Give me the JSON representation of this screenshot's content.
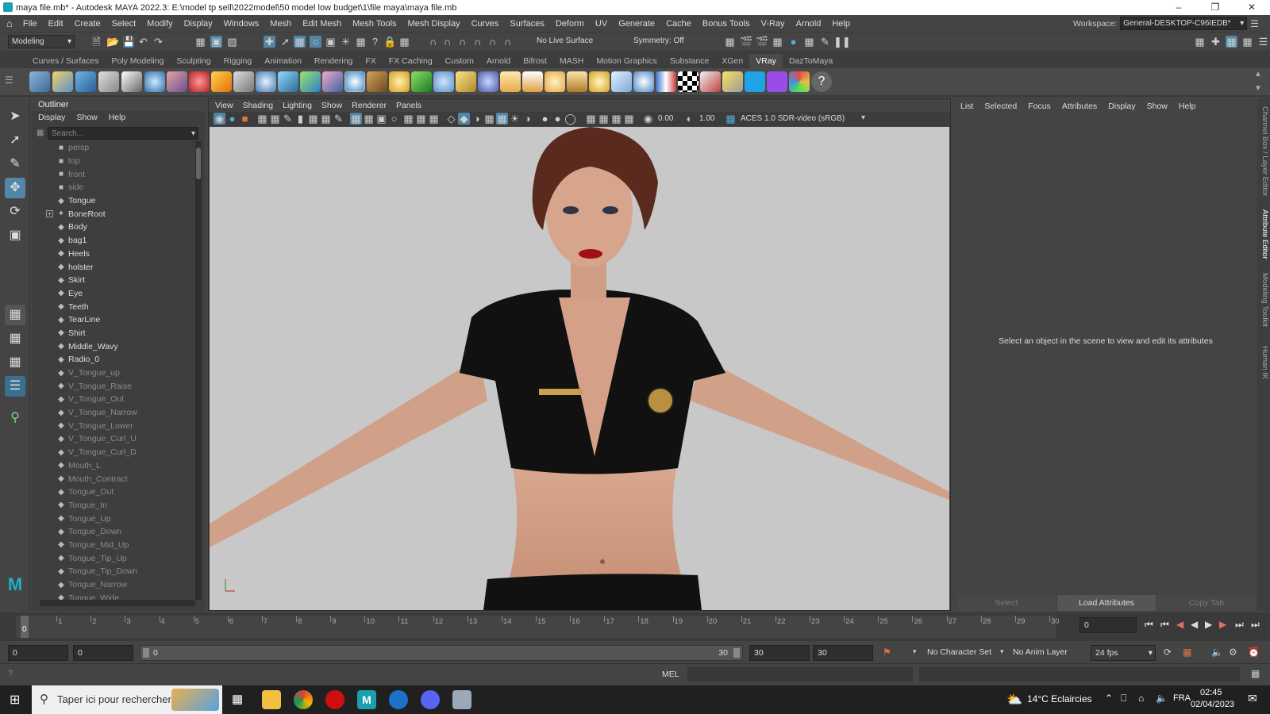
{
  "window": {
    "title": "maya file.mb* - Autodesk MAYA 2022.3: E:\\model tp sell\\2022model\\50 model low budget\\1\\file maya\\maya file.mb"
  },
  "menubar": {
    "items": [
      "File",
      "Edit",
      "Create",
      "Select",
      "Modify",
      "Display",
      "Windows",
      "Mesh",
      "Edit Mesh",
      "Mesh Tools",
      "Mesh Display",
      "Curves",
      "Surfaces",
      "Deform",
      "UV",
      "Generate",
      "Cache",
      "Bonus Tools",
      "V-Ray",
      "Arnold",
      "Help"
    ],
    "workspace_label": "Workspace:",
    "workspace_value": "General-DESKTOP-C96IEDB*"
  },
  "statusline": {
    "mode": "Modeling",
    "live_surface": "No Live Surface",
    "symmetry": "Symmetry: Off"
  },
  "shelf": {
    "tabs": [
      "Curves / Surfaces",
      "Poly Modeling",
      "Sculpting",
      "Rigging",
      "Animation",
      "Rendering",
      "FX",
      "FX Caching",
      "Custom",
      "Arnold",
      "Bifrost",
      "MASH",
      "Motion Graphics",
      "Substance",
      "XGen",
      "VRay",
      "DazToMaya"
    ],
    "active_tab": "VRay"
  },
  "outliner": {
    "title": "Outliner",
    "menu": [
      "Display",
      "Show",
      "Help"
    ],
    "search_placeholder": "Search...",
    "items": [
      {
        "label": "persp",
        "icon": "camera-icon",
        "dim": true
      },
      {
        "label": "top",
        "icon": "camera-icon",
        "dim": true
      },
      {
        "label": "front",
        "icon": "camera-icon",
        "dim": true
      },
      {
        "label": "side",
        "icon": "camera-icon",
        "dim": true
      },
      {
        "label": "Tongue",
        "icon": "mesh-icon",
        "dim": false
      },
      {
        "label": "BoneRoot",
        "icon": "joint-icon",
        "dim": false,
        "expandable": true
      },
      {
        "label": "Body",
        "icon": "mesh-icon",
        "dim": false
      },
      {
        "label": "bag1",
        "icon": "mesh-icon",
        "dim": false
      },
      {
        "label": "Heels",
        "icon": "mesh-icon",
        "dim": false
      },
      {
        "label": "holster",
        "icon": "mesh-icon",
        "dim": false
      },
      {
        "label": "Skirt",
        "icon": "mesh-icon",
        "dim": false
      },
      {
        "label": "Eye",
        "icon": "mesh-icon",
        "dim": false
      },
      {
        "label": "Teeth",
        "icon": "mesh-icon",
        "dim": false
      },
      {
        "label": "TearLine",
        "icon": "mesh-icon",
        "dim": false
      },
      {
        "label": "Shirt",
        "icon": "mesh-icon",
        "dim": false
      },
      {
        "label": "Middle_Wavy",
        "icon": "mesh-icon",
        "dim": false
      },
      {
        "label": "Radio_0",
        "icon": "mesh-icon",
        "dim": false
      },
      {
        "label": "V_Tongue_up",
        "icon": "mesh-icon",
        "dim": true
      },
      {
        "label": "V_Tongue_Raise",
        "icon": "mesh-icon",
        "dim": true
      },
      {
        "label": "V_Tongue_Out",
        "icon": "mesh-icon",
        "dim": true
      },
      {
        "label": "V_Tongue_Narrow",
        "icon": "mesh-icon",
        "dim": true
      },
      {
        "label": "V_Tongue_Lower",
        "icon": "mesh-icon",
        "dim": true
      },
      {
        "label": "V_Tongue_Curl_U",
        "icon": "mesh-icon",
        "dim": true
      },
      {
        "label": "V_Tongue_Curl_D",
        "icon": "mesh-icon",
        "dim": true
      },
      {
        "label": "Mouth_L",
        "icon": "mesh-icon",
        "dim": true
      },
      {
        "label": "Mouth_Contract",
        "icon": "mesh-icon",
        "dim": true
      },
      {
        "label": "Tongue_Out",
        "icon": "mesh-icon",
        "dim": true
      },
      {
        "label": "Tongue_In",
        "icon": "mesh-icon",
        "dim": true
      },
      {
        "label": "Tongue_Up",
        "icon": "mesh-icon",
        "dim": true
      },
      {
        "label": "Tongue_Down",
        "icon": "mesh-icon",
        "dim": true
      },
      {
        "label": "Tongue_Mid_Up",
        "icon": "mesh-icon",
        "dim": true
      },
      {
        "label": "Tongue_Tip_Up",
        "icon": "mesh-icon",
        "dim": true
      },
      {
        "label": "Tongue_Tip_Down",
        "icon": "mesh-icon",
        "dim": true
      },
      {
        "label": "Tongue_Narrow",
        "icon": "mesh-icon",
        "dim": true
      },
      {
        "label": "Tongue_Wide",
        "icon": "mesh-icon",
        "dim": true
      }
    ]
  },
  "viewport": {
    "menu": [
      "View",
      "Shading",
      "Lighting",
      "Show",
      "Renderer",
      "Panels"
    ],
    "exposure": "0.00",
    "gamma": "1.00",
    "color_space": "ACES 1.0 SDR-video (sRGB)",
    "background_color": "#c8c8c8"
  },
  "attribute_editor": {
    "menu": [
      "List",
      "Selected",
      "Focus",
      "Attributes",
      "Display",
      "Show",
      "Help"
    ],
    "message": "Select an object in the scene to view and edit its attributes",
    "buttons": [
      "Select",
      "Load Attributes",
      "Copy Tab"
    ]
  },
  "right_tabs": [
    "Channel Box / Layer Editor",
    "Attribute Editor",
    "Modeling Toolkit",
    "Human IK"
  ],
  "timeline": {
    "frames": [
      "0",
      "1",
      "2",
      "3",
      "4",
      "5",
      "6",
      "7",
      "8",
      "9",
      "10",
      "11",
      "12",
      "13",
      "14",
      "15",
      "16",
      "17",
      "18",
      "19",
      "20",
      "21",
      "22",
      "23",
      "24",
      "25",
      "26",
      "27",
      "28",
      "29",
      "30"
    ],
    "current_frame": "0",
    "current_frame_field": "0"
  },
  "range": {
    "start": "0",
    "anim_start": "0",
    "range_start_label": "0",
    "range_end_label": "30",
    "anim_end": "30",
    "end": "30",
    "character_set": "No Character Set",
    "anim_layer": "No Anim Layer",
    "fps": "24 fps"
  },
  "cmdline": {
    "lang": "MEL"
  },
  "taskbar": {
    "search_text": "Taper ici pour rechercher",
    "weather": "14°C  Eclaircies",
    "lang": "FRA",
    "time": "02:45",
    "date": "02/04/2023"
  }
}
